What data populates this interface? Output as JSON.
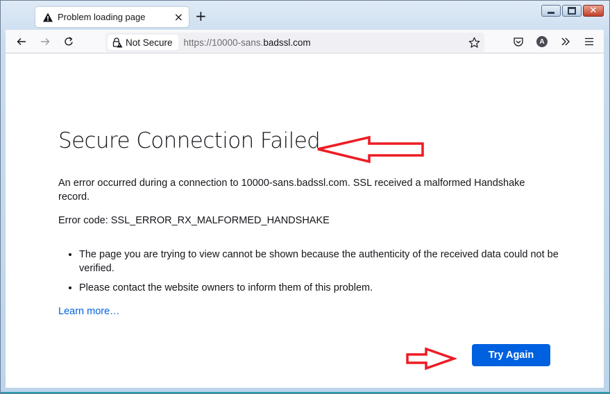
{
  "window": {
    "controls": {
      "minimize": "minimize",
      "maximize": "maximize",
      "close": "close"
    }
  },
  "tab": {
    "title": "Problem loading page",
    "icon": "warning-icon",
    "close_glyph": "×"
  },
  "new_tab_glyph": "+",
  "toolbar": {
    "back": "back-icon",
    "forward": "forward-icon",
    "reload": "reload-icon",
    "identity_label": "Not Secure",
    "url_prefix": "https://10000-sans.",
    "url_host": "badssl.com",
    "bookmark": "star-icon",
    "pocket": "pocket-icon",
    "account_initial": "A",
    "overflow": "chevrons-icon",
    "menu": "hamburger-icon"
  },
  "error_page": {
    "title": "Secure Connection Failed",
    "description": "An error occurred during a connection to 10000-sans.badssl.com. SSL received a malformed Handshake record.",
    "error_code": "Error code: SSL_ERROR_RX_MALFORMED_HANDSHAKE",
    "bullets": [
      "The page you are trying to view cannot be shown because the authenticity of the received data could not be verified.",
      "Please contact the website owners to inform them of this problem."
    ],
    "learn_more": "Learn more…",
    "try_again": "Try Again"
  },
  "annotations": {
    "color": "#ed1c24",
    "arrows": [
      "arrow pointing left at title",
      "arrow pointing right at Try Again button"
    ]
  }
}
